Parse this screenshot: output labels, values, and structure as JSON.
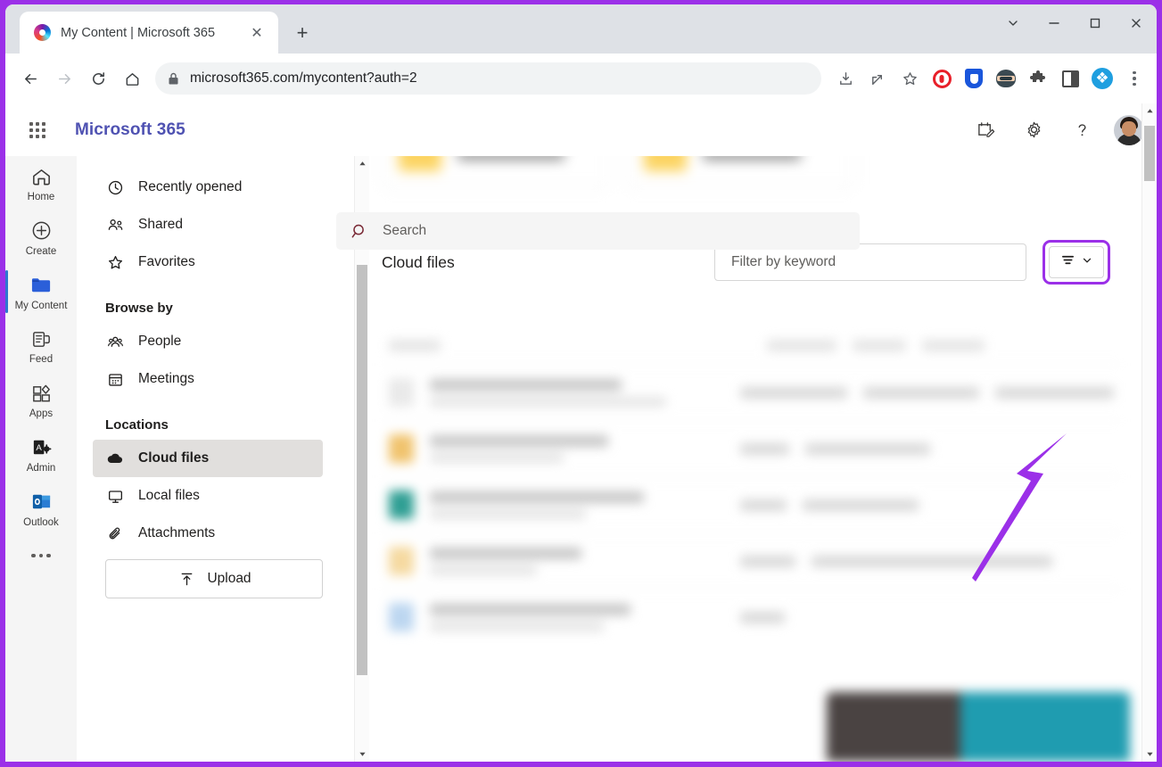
{
  "browser": {
    "tab": {
      "title": "My Content | Microsoft 365",
      "favicon": "microsoft365-favicon",
      "close_label": "✕"
    },
    "new_tab_label": "+",
    "window_controls": {
      "tab_search": "tab-search-chevron",
      "minimize": "minimize",
      "maximize": "maximize",
      "close": "close"
    },
    "toolbar": {
      "back": "back-arrow",
      "forward": "forward-arrow",
      "reload": "reload",
      "home": "home",
      "lock": "lock-icon",
      "url": "microsoft365.com/mycontent?auth=2",
      "actions": [
        "download-icon",
        "share-icon",
        "bookmark-star-icon"
      ],
      "extensions": [
        "opera-adblock-icon",
        "shield-icon",
        "ninja-icon",
        "puzzle-piece-icon",
        "split-screen-icon",
        "spiral-logo-icon"
      ],
      "menu": "three-dot-menu"
    }
  },
  "header": {
    "waffle": "app-launcher-icon",
    "brand": "Microsoft 365",
    "search_placeholder": "Search",
    "icons": [
      "notepad-edit-icon",
      "gear-icon",
      "help-icon"
    ],
    "avatar": "user-avatar"
  },
  "app_rail": {
    "items": [
      {
        "label": "Home",
        "icon": "home-icon",
        "active": false
      },
      {
        "label": "Create",
        "icon": "plus-circle-icon",
        "active": false
      },
      {
        "label": "My Content",
        "icon": "folder-icon",
        "active": true
      },
      {
        "label": "Feed",
        "icon": "feed-icon",
        "active": false
      },
      {
        "label": "Apps",
        "icon": "apps-grid-icon",
        "active": false
      },
      {
        "label": "Admin",
        "icon": "admin-icon",
        "active": false
      },
      {
        "label": "Outlook",
        "icon": "outlook-icon",
        "active": false
      }
    ],
    "more_label": "more-apps"
  },
  "sidebar": {
    "items": [
      {
        "label": "Recently opened",
        "icon": "clock-icon"
      },
      {
        "label": "Shared",
        "icon": "people-icon"
      },
      {
        "label": "Favorites",
        "icon": "star-icon"
      }
    ],
    "browse_by_header": "Browse by",
    "browse_by": [
      {
        "label": "People",
        "icon": "people-group-icon"
      },
      {
        "label": "Meetings",
        "icon": "calendar-icon"
      }
    ],
    "locations_header": "Locations",
    "locations": [
      {
        "label": "Cloud files",
        "icon": "cloud-icon",
        "selected": true
      },
      {
        "label": "Local files",
        "icon": "monitor-icon",
        "selected": false
      },
      {
        "label": "Attachments",
        "icon": "paperclip-icon",
        "selected": false
      }
    ],
    "upload_label": "Upload",
    "upload_icon": "upload-arrow-icon"
  },
  "main": {
    "cloud_files_title": "Cloud files",
    "filter_placeholder": "Filter by keyword",
    "filter_button": {
      "icon": "filter-lines-icon",
      "chevron": "chevron-down-icon",
      "highlighted": true
    },
    "folder_cards": [
      {
        "icon": "yellow-folder-icon",
        "name_blurred": true
      },
      {
        "icon": "yellow-folder-icon",
        "name_blurred": true
      }
    ],
    "file_rows_blurred": true,
    "chat_widget_present": true
  },
  "annotation": {
    "arrow_color": "#9b30e8",
    "highlight_color": "#9b30e8",
    "points_to": "filter-button"
  },
  "colors": {
    "window_border": "#9b30e8",
    "brand": "#4f52b2",
    "tabstrip": "#dee1e6",
    "rail_bg": "#f5f5f5",
    "selected_nav": "#e1dfdd",
    "active_accent": "#2e77d0"
  }
}
